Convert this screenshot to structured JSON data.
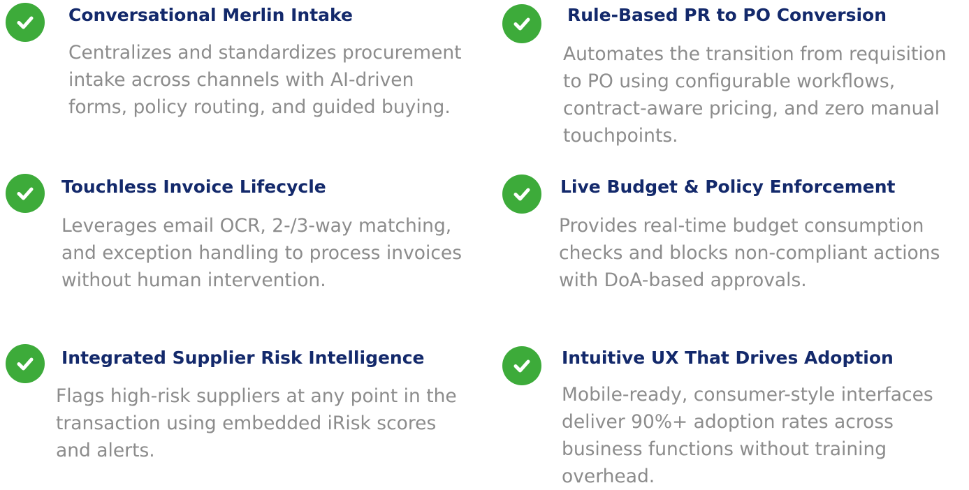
{
  "features": [
    {
      "icon": "check-circle-icon",
      "title": "Conversational Merlin Intake",
      "description": [
        "Centralizes and standardizes procurement",
        "intake across channels with AI-driven",
        "forms, policy routing, and guided buying."
      ]
    },
    {
      "icon": "check-circle-icon",
      "title": "Rule-Based PR to PO Conversion",
      "description": [
        "Automates the transition from requisition",
        "to PO using configurable workflows,",
        "contract-aware pricing, and zero manual",
        "touchpoints."
      ]
    },
    {
      "icon": "check-circle-icon",
      "title": "Touchless Invoice Lifecycle",
      "description": [
        "Leverages email OCR, 2-/3-way matching,",
        "and exception handling to process invoices",
        "without human intervention."
      ]
    },
    {
      "icon": "check-circle-icon",
      "title": "Live Budget & Policy Enforcement",
      "description": [
        "Provides real-time budget consumption",
        "checks and blocks non-compliant actions",
        "with DoA-based approvals."
      ]
    },
    {
      "icon": "check-circle-icon",
      "title": "Integrated Supplier Risk Intelligence",
      "description": [
        "Flags high-risk suppliers at any point in the",
        "transaction using embedded iRisk scores",
        "and alerts."
      ]
    },
    {
      "icon": "check-circle-icon",
      "title": "Intuitive UX That Drives Adoption",
      "description": [
        "Mobile-ready, consumer-style interfaces",
        "deliver 90%+ adoption rates across",
        "business functions without training",
        "overhead."
      ]
    }
  ],
  "colors": {
    "check_green": "#3dab3a",
    "title_navy": "#13296b",
    "body_gray": "#8c8c8c"
  }
}
